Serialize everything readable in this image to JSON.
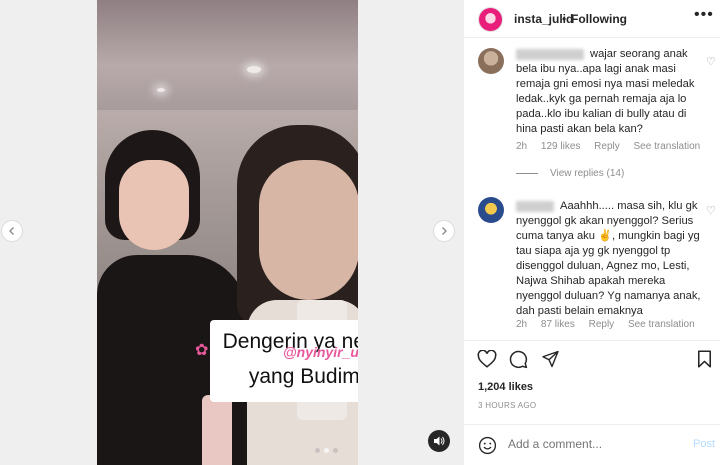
{
  "video": {
    "caption_line1": "Dengerin ya netizen",
    "caption_line2": "yang Budiman",
    "watermark": "@nyinyir_update_official",
    "slide_count": 3,
    "active_slide": 2
  },
  "header": {
    "username": "insta_julid",
    "separator": "•",
    "follow_status": "Following",
    "more": "•••"
  },
  "comments": [
    {
      "text": "wajar seorang anak bela ibu nya..apa lagi anak masi remaja gni emosi nya masi meledak ledak..kyk ga pernah remaja aja lo pada..klo ibu kalian di bully atau di hina pasti akan bela kan?",
      "time": "2h",
      "likes": "129 likes",
      "reply": "Reply",
      "translate": "See translation",
      "view_replies": "View replies (14)"
    },
    {
      "text": "Aaahhh..... masa sih, klu gk nyenggol gk akan nyenggol? Serius cuma tanya aku ✌️, mungkin bagi yg tau siapa aja yg gk nyenggol tp disenggol duluan, Agnez mo, Lesti, Najwa Shihab apakah mereka nyenggol duluan? Yg namanya anak, dah pasti belain emaknya",
      "time": "2h",
      "likes": "87 likes",
      "reply": "Reply",
      "translate": "See translation"
    }
  ],
  "post": {
    "likes": "1,204 likes",
    "time_ago": "3 HOURS AGO"
  },
  "composer": {
    "placeholder": "Add a comment...",
    "post_label": "Post"
  },
  "colors": {
    "accent": "#0095f6",
    "post_disabled": "#b3dbff",
    "watermark": "#e8599c",
    "muted": "#8e8e8e"
  }
}
